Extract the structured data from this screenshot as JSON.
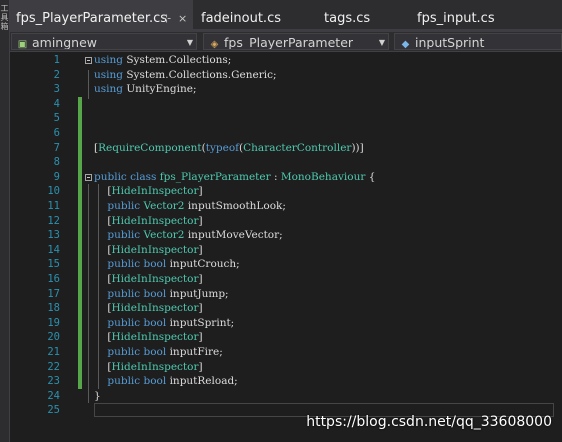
{
  "side_panel": {
    "label": "工具箱"
  },
  "tabs": [
    {
      "label": "fps_PlayerParameter.cs",
      "active": true,
      "pin": "⊹",
      "close": "×"
    },
    {
      "label": "fadeinout.cs",
      "active": false
    },
    {
      "label": "tags.cs",
      "active": false
    },
    {
      "label": "fps_input.cs",
      "active": false
    }
  ],
  "navbar": {
    "project": {
      "label": "amingnew",
      "icon": "csharp-project-icon"
    },
    "class": {
      "label": "fps_PlayerParameter",
      "icon": "class-icon"
    },
    "member": {
      "label": "inputSprint",
      "icon": "field-icon"
    }
  },
  "editor": {
    "colors": {
      "keyword": "#569cd6",
      "type": "#4ec9b0",
      "plain": "#dcdcdc",
      "line_number": "#2b91af",
      "changed": "#57a64a"
    },
    "line_numbers": [
      "1",
      "2",
      "3",
      "4",
      "5",
      "6",
      "7",
      "8",
      "9",
      "10",
      "11",
      "12",
      "13",
      "14",
      "15",
      "16",
      "17",
      "18",
      "19",
      "20",
      "21",
      "22",
      "23",
      "24",
      "25"
    ],
    "lines": [
      [
        [
          "kw",
          "using"
        ],
        [
          "pl",
          " System.Collections;"
        ]
      ],
      [
        [
          "kw",
          "using"
        ],
        [
          "pl",
          " System.Collections.Generic;"
        ]
      ],
      [
        [
          "kw",
          "using"
        ],
        [
          "pl",
          " UnityEngine;"
        ]
      ],
      [],
      [],
      [],
      [
        [
          "pl",
          "["
        ],
        [
          "tp",
          "RequireComponent"
        ],
        [
          "pl",
          "("
        ],
        [
          "kw",
          "typeof"
        ],
        [
          "pl",
          "("
        ],
        [
          "tp",
          "CharacterController"
        ],
        [
          "pl",
          "))]"
        ]
      ],
      [],
      [
        [
          "kw",
          "public class"
        ],
        [
          "pl",
          " "
        ],
        [
          "tp",
          "fps_PlayerParameter"
        ],
        [
          "pl",
          " : "
        ],
        [
          "tp",
          "MonoBehaviour"
        ],
        [
          "pl",
          " {"
        ]
      ],
      [
        [
          "pl",
          "    ["
        ],
        [
          "tp",
          "HideInInspector"
        ],
        [
          "pl",
          "]"
        ]
      ],
      [
        [
          "pl",
          "    "
        ],
        [
          "kw",
          "public"
        ],
        [
          "pl",
          " "
        ],
        [
          "tp",
          "Vector2"
        ],
        [
          "pl",
          " inputSmoothLook;"
        ]
      ],
      [
        [
          "pl",
          "    ["
        ],
        [
          "tp",
          "HideInInspector"
        ],
        [
          "pl",
          "]"
        ]
      ],
      [
        [
          "pl",
          "    "
        ],
        [
          "kw",
          "public"
        ],
        [
          "pl",
          " "
        ],
        [
          "tp",
          "Vector2"
        ],
        [
          "pl",
          " inputMoveVector;"
        ]
      ],
      [
        [
          "pl",
          "    ["
        ],
        [
          "tp",
          "HideInInspector"
        ],
        [
          "pl",
          "]"
        ]
      ],
      [
        [
          "pl",
          "    "
        ],
        [
          "kw",
          "public bool"
        ],
        [
          "pl",
          " inputCrouch;"
        ]
      ],
      [
        [
          "pl",
          "    ["
        ],
        [
          "tp",
          "HideInInspector"
        ],
        [
          "pl",
          "]"
        ]
      ],
      [
        [
          "pl",
          "    "
        ],
        [
          "kw",
          "public bool"
        ],
        [
          "pl",
          " inputJump;"
        ]
      ],
      [
        [
          "pl",
          "    ["
        ],
        [
          "tp",
          "HideInInspector"
        ],
        [
          "pl",
          "]"
        ]
      ],
      [
        [
          "pl",
          "    "
        ],
        [
          "kw",
          "public bool"
        ],
        [
          "pl",
          " inputSprint;"
        ]
      ],
      [
        [
          "pl",
          "    ["
        ],
        [
          "tp",
          "HideInInspector"
        ],
        [
          "pl",
          "]"
        ]
      ],
      [
        [
          "pl",
          "    "
        ],
        [
          "kw",
          "public bool"
        ],
        [
          "pl",
          " inputFire;"
        ]
      ],
      [
        [
          "pl",
          "    ["
        ],
        [
          "tp",
          "HideInInspector"
        ],
        [
          "pl",
          "]"
        ]
      ],
      [
        [
          "pl",
          "    "
        ],
        [
          "kw",
          "public bool"
        ],
        [
          "pl",
          " inputReload;"
        ]
      ],
      [
        [
          "pl",
          "}"
        ]
      ],
      []
    ]
  },
  "watermark": "https://blog.csdn.net/qq_33608000"
}
